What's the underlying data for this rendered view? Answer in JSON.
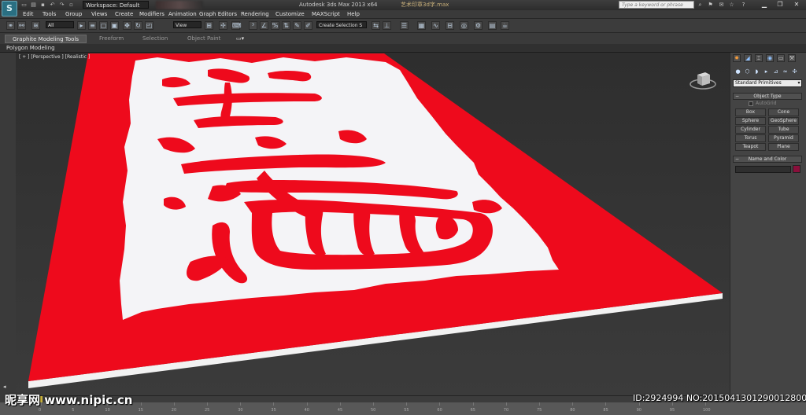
{
  "title_bar": {
    "app_title": "Autodesk 3ds Max 2013 x64",
    "file_name": "艺术印章3d字.max",
    "workspace": "Workspace: Default",
    "search_placeholder": "Type a keyword or phrase"
  },
  "menu": [
    "Edit",
    "Tools",
    "Group",
    "Views",
    "Create",
    "Modifiers",
    "Animation",
    "Graph Editors",
    "Rendering",
    "Customize",
    "MAXScript",
    "Help"
  ],
  "toolbar": {
    "selection_filter": "All",
    "ref_coord": "View",
    "named_selection": "Create Selection S"
  },
  "ribbon": {
    "tabs": [
      "Graphite Modeling Tools",
      "Freeform",
      "Selection",
      "Object Paint"
    ],
    "active_tab": "Graphite Modeling Tools",
    "sub_label": "Polygon Modeling"
  },
  "viewport": {
    "label": "[ + ] [Perspective ] [Realistic ]",
    "scene": "red seal plate with white raised base and red Chinese calligraphy characters"
  },
  "command_panel": {
    "category_select": "Standard Primitives",
    "object_type_title": "Object Type",
    "autogrid_label": "AutoGrid",
    "object_buttons": [
      "Box",
      "Cone",
      "Sphere",
      "GeoSphere",
      "Cylinder",
      "Tube",
      "Torus",
      "Pyramid",
      "Teapot",
      "Plane"
    ],
    "name_color_title": "Name and Color",
    "object_color": "#8a0f3b"
  },
  "timeline": {
    "ticks": [
      "0",
      "5",
      "10",
      "15",
      "20",
      "25",
      "30",
      "35",
      "40",
      "45",
      "50",
      "55",
      "60",
      "65",
      "70",
      "75",
      "80",
      "85",
      "90",
      "95",
      "100"
    ]
  },
  "watermark": {
    "left_text": "昵享网 www.nipic.cn",
    "right_text": "ID:2924994 NO:20150413012900128000"
  },
  "colors": {
    "seal_red": "#ee0a1c",
    "base_white": "#f4f4f7",
    "viewport_border": "#c8a23a"
  }
}
